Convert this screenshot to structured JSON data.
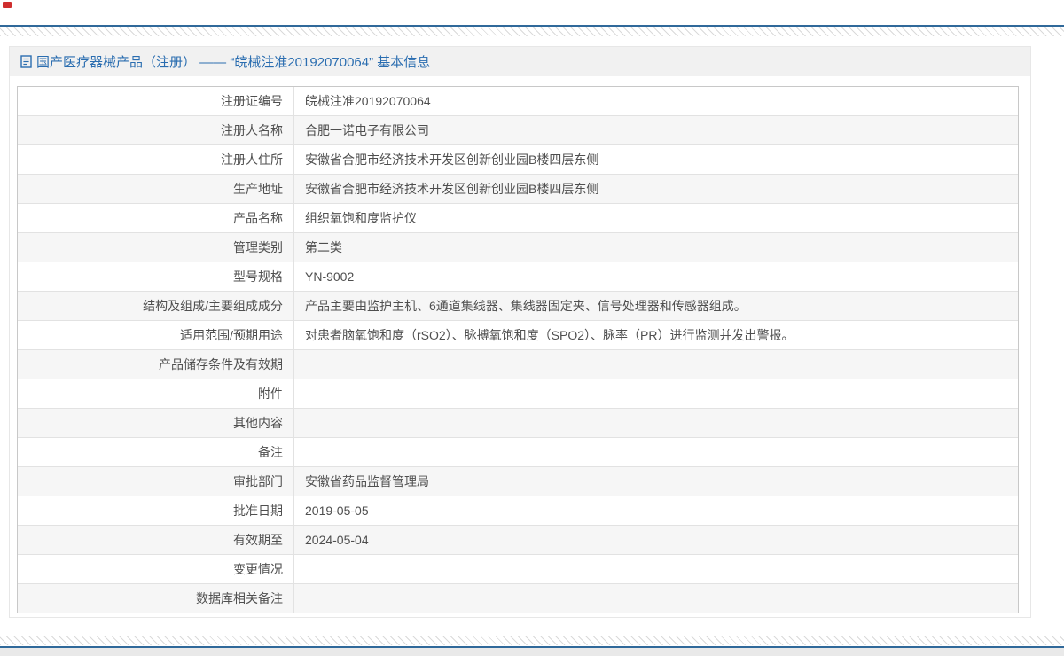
{
  "header": {
    "icon": "document-icon",
    "title": "国产医疗器械产品（注册） —— “皖械注准20192070064” 基本信息"
  },
  "table": {
    "rows": [
      {
        "label": "注册证编号",
        "value": "皖械注准20192070064"
      },
      {
        "label": "注册人名称",
        "value": "合肥一诺电子有限公司"
      },
      {
        "label": "注册人住所",
        "value": "安徽省合肥市经济技术开发区创新创业园B楼四层东侧"
      },
      {
        "label": "生产地址",
        "value": "安徽省合肥市经济技术开发区创新创业园B楼四层东侧"
      },
      {
        "label": "产品名称",
        "value": "组织氧饱和度监护仪"
      },
      {
        "label": "管理类别",
        "value": "第二类"
      },
      {
        "label": "型号规格",
        "value": "YN-9002"
      },
      {
        "label": "结构及组成/主要组成成分",
        "value": "产品主要由监护主机、6通道集线器、集线器固定夹、信号处理器和传感器组成。"
      },
      {
        "label": "适用范围/预期用途",
        "value": "对患者脑氧饱和度（rSO2）、脉搏氧饱和度（SPO2）、脉率（PR）进行监测并发出警报。"
      },
      {
        "label": "产品储存条件及有效期",
        "value": ""
      },
      {
        "label": "附件",
        "value": ""
      },
      {
        "label": "其他内容",
        "value": ""
      },
      {
        "label": "备注",
        "value": ""
      },
      {
        "label": "审批部门",
        "value": "安徽省药品监督管理局"
      },
      {
        "label": "批准日期",
        "value": "2019-05-05"
      },
      {
        "label": "有效期至",
        "value": "2024-05-04"
      },
      {
        "label": "变更情况",
        "value": ""
      },
      {
        "label": "数据库相关备注",
        "value": ""
      }
    ]
  },
  "colors": {
    "accent_blue": "#2a6db0",
    "frame_line_blue": "#30699a",
    "header_bar_bg": "#f1f1f1",
    "alt_row_bg": "#f6f6f6",
    "table_border": "#c8c8c8",
    "text": "#4f4f4f",
    "bottom_strip": "#e9e9e9",
    "red_mark": "#cf2e2e"
  }
}
